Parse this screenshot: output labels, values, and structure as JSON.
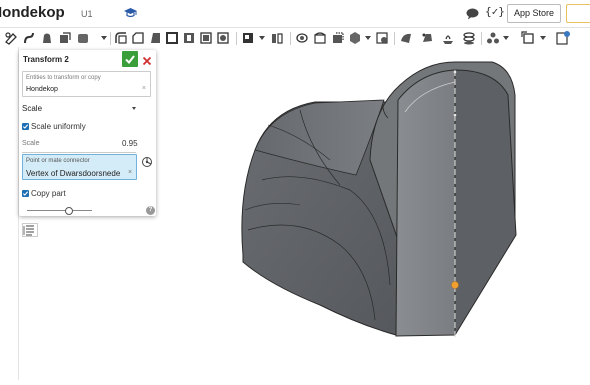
{
  "app": {
    "document_title": "Iondekop",
    "document_version": "U1",
    "app_store_label": "App Store",
    "variables_icon_text": "{✓}"
  },
  "toolbar": {
    "icons": [
      "sketch-icon",
      "extrude-icon",
      "revolve-icon",
      "sweep-icon",
      "loft-icon",
      "thicken-icon",
      "fillet-icon",
      "chamfer-icon",
      "draft-icon",
      "shell-icon",
      "hole-icon",
      "boolean-icon",
      "split-icon",
      "transform-icon",
      "pattern-icon",
      "mirror-icon",
      "plane-icon",
      "helix-icon",
      "mate-connector-icon",
      "sheet-metal-icon",
      "surface-icon",
      "measure-icon",
      "section-icon",
      "variable-icon",
      "display-icon",
      "feature-script-icon"
    ]
  },
  "dialog": {
    "title": "Transform 2",
    "entities_label": "Entities to transform or copy",
    "entities_value": "Hondekop",
    "transform_type": "Scale",
    "scale_uniformly_label": "Scale uniformly",
    "scale_uniformly_checked": true,
    "scale_label": "Scale",
    "scale_value": "0.95",
    "point_label": "Point or mate connector",
    "point_value": "Vertex of Dwarsdoorsnede",
    "copy_part_label": "Copy part",
    "copy_part_checked": true,
    "slider_fraction": 0.65,
    "help_icon_text": "?"
  },
  "colors": {
    "accent_green": "#3a9e3a",
    "accent_red": "#d03030",
    "selection_blue": "#d4ecf8",
    "checkbox_blue": "#1f6fb5",
    "model_gray": "#6b6e72",
    "highlight_orange": "#f0a030"
  }
}
